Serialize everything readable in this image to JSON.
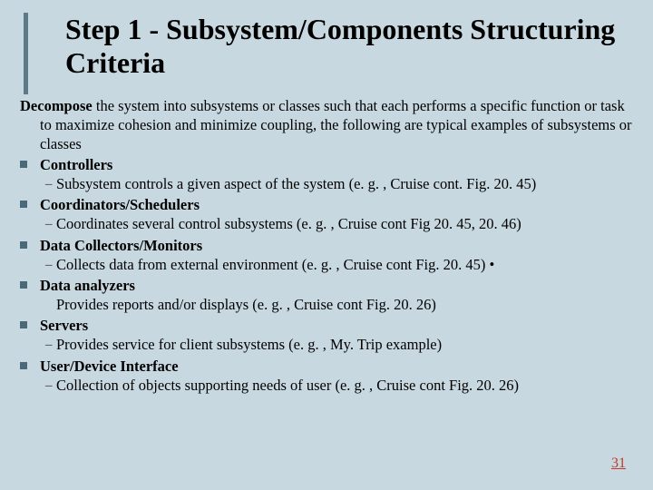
{
  "title": "Step 1 - Subsystem/Components Structuring Criteria",
  "intro_lead": "Decompose",
  "intro_rest": " the system into subsystems or classes such that each performs a specific function or task to maximize cohesion and minimize coupling, the following are typical examples of subsystems or classes",
  "items": [
    {
      "label": "Controllers",
      "sub": "Subsystem controls a given aspect of the system (e. g. , Cruise cont. Fig. 20. 45)",
      "dash": true
    },
    {
      "label": "Coordinators/Schedulers",
      "sub": "Coordinates several control subsystems (e. g. , Cruise cont Fig 20. 45, 20. 46)",
      "dash": true
    },
    {
      "label": "Data Collectors/Monitors",
      "sub": "Collects data from external environment (e. g. , Cruise cont Fig. 20. 45) •",
      "dash": true
    },
    {
      "label": "Data analyzers",
      "sub": "Provides reports and/or displays (e. g. , Cruise cont Fig. 20. 26)",
      "dash": false
    },
    {
      "label": "Servers",
      "sub": "Provides service for client subsystems (e. g. , My. Trip example)",
      "dash": true
    },
    {
      "label": "User/Device Interface",
      "sub": "Collection of objects supporting needs of user (e. g. , Cruise cont Fig. 20. 26)",
      "dash": true
    }
  ],
  "page_number": "31"
}
